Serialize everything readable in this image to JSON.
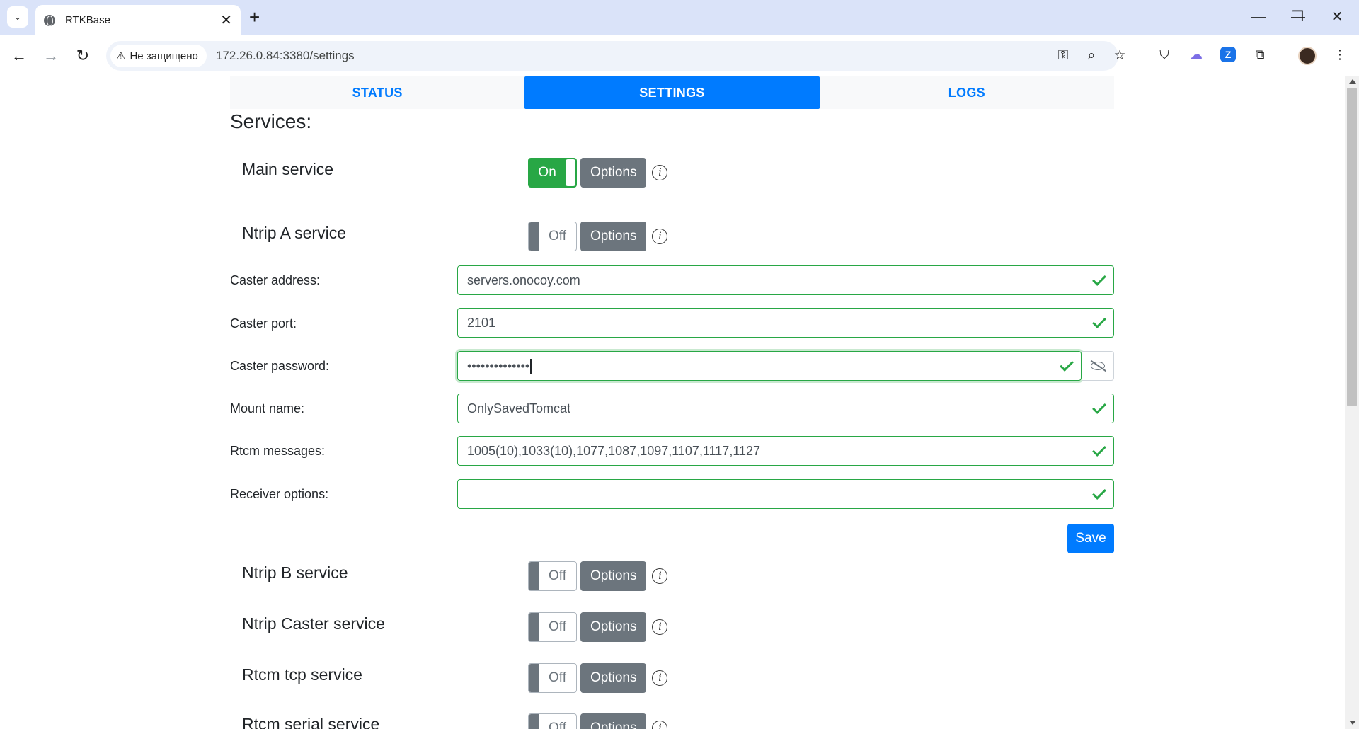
{
  "browser": {
    "tab_title": "RTKBase",
    "security_label": "Не защищено",
    "url": "172.26.0.84:3380/settings"
  },
  "nav": {
    "tabs": [
      {
        "label": "STATUS"
      },
      {
        "label": "SETTINGS"
      },
      {
        "label": "LOGS"
      }
    ],
    "active": "SETTINGS"
  },
  "page": {
    "section_title": "Services:"
  },
  "services": [
    {
      "label": "Main service",
      "state": "On",
      "options_label": "Options"
    },
    {
      "label": "Ntrip A service",
      "state": "Off",
      "options_label": "Options"
    },
    {
      "label": "Ntrip B service",
      "state": "Off",
      "options_label": "Options"
    },
    {
      "label": "Ntrip Caster service",
      "state": "Off",
      "options_label": "Options"
    },
    {
      "label": "Rtcm tcp service",
      "state": "Off",
      "options_label": "Options"
    },
    {
      "label": "Rtcm serial service",
      "state": "Off",
      "options_label": "Options"
    }
  ],
  "ntrip_a_form": {
    "fields": [
      {
        "label": "Caster address:",
        "value": "servers.onocoy.com"
      },
      {
        "label": "Caster port:",
        "value": "2101"
      },
      {
        "label": "Caster password:",
        "value": "••••••••••••••"
      },
      {
        "label": "Mount name:",
        "value": "OnlySavedTomcat"
      },
      {
        "label": "Rtcm messages:",
        "value": "1005(10),1033(10),1077,1087,1097,1107,1117,1127"
      },
      {
        "label": "Receiver options:",
        "value": ""
      }
    ],
    "save_label": "Save"
  },
  "colors": {
    "primary": "#007bff",
    "success": "#28a745",
    "secondary": "#6c757d"
  }
}
